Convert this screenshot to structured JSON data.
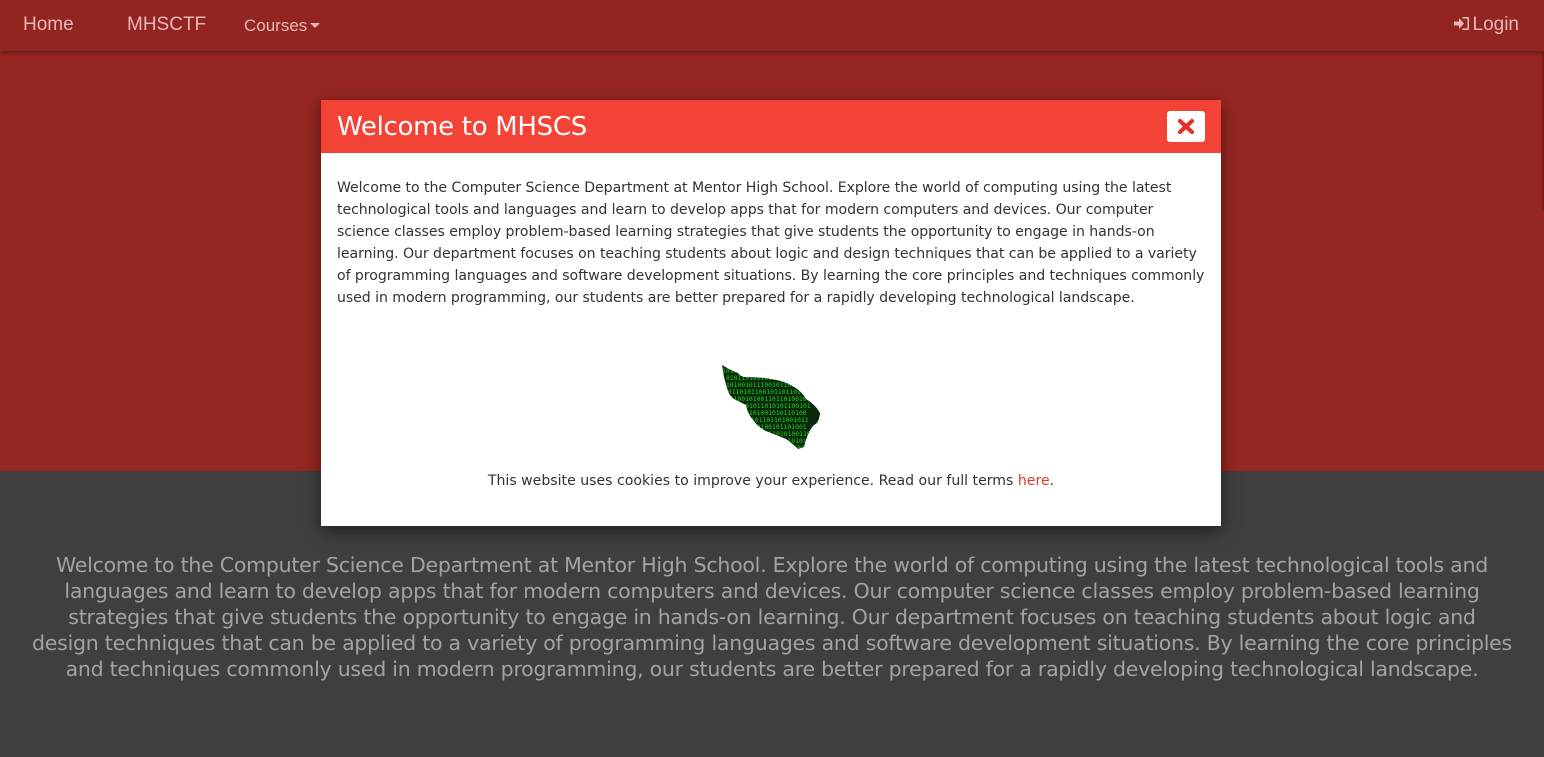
{
  "nav": {
    "home": "Home",
    "mhsctf": "MHSCTF",
    "courses": "Courses",
    "login": "Login"
  },
  "about": {
    "text": "Welcome to the Computer Science Department at Mentor High School. Explore the world of computing using the latest technological tools and languages and learn to develop apps that for modern computers and devices. Our computer science classes employ problem-based learning strategies that give students the opportunity to engage in hands-on learning. Our department focuses on teaching students about logic and design techniques that can be applied to a variety of programming languages and software development situations. By learning the core principles and techniques commonly used in modern programming, our students are better prepared for a rapidly developing technological landscape."
  },
  "modal": {
    "title": "Welcome to MHSCS",
    "body": "Welcome to the Computer Science Department at Mentor High School. Explore the world of computing using the latest technological tools and languages and learn to develop apps that for modern computers and devices. Our computer science classes employ problem-based learning strategies that give students the opportunity to engage in hands-on learning. Our department focuses on teaching students about logic and design techniques that can be applied to a variety of programming languages and software development situations. By learning the core principles and techniques commonly used in modern programming, our students are better prepared for a rapidly developing technological landscape.",
    "cookie_text": "This website uses cookies to improve your experience. Read our full terms ",
    "cookie_link": "here",
    "cookie_end": ".",
    "mascot_binary": "1010110001101110 0101101001011010 1101001011100101 0011010110010110 1011001010011011 0101101011010101"
  },
  "colors": {
    "navbar": "#922521",
    "hero": "#962621",
    "about_bg": "#3f3f3f",
    "modal_header": "#f34337",
    "mascot_binary": "#1ecb1e"
  },
  "icons": {
    "caret": "caret-down-icon",
    "login": "sign-in-icon",
    "close": "close-icon",
    "mascot": "binary-cardinal-logo"
  }
}
